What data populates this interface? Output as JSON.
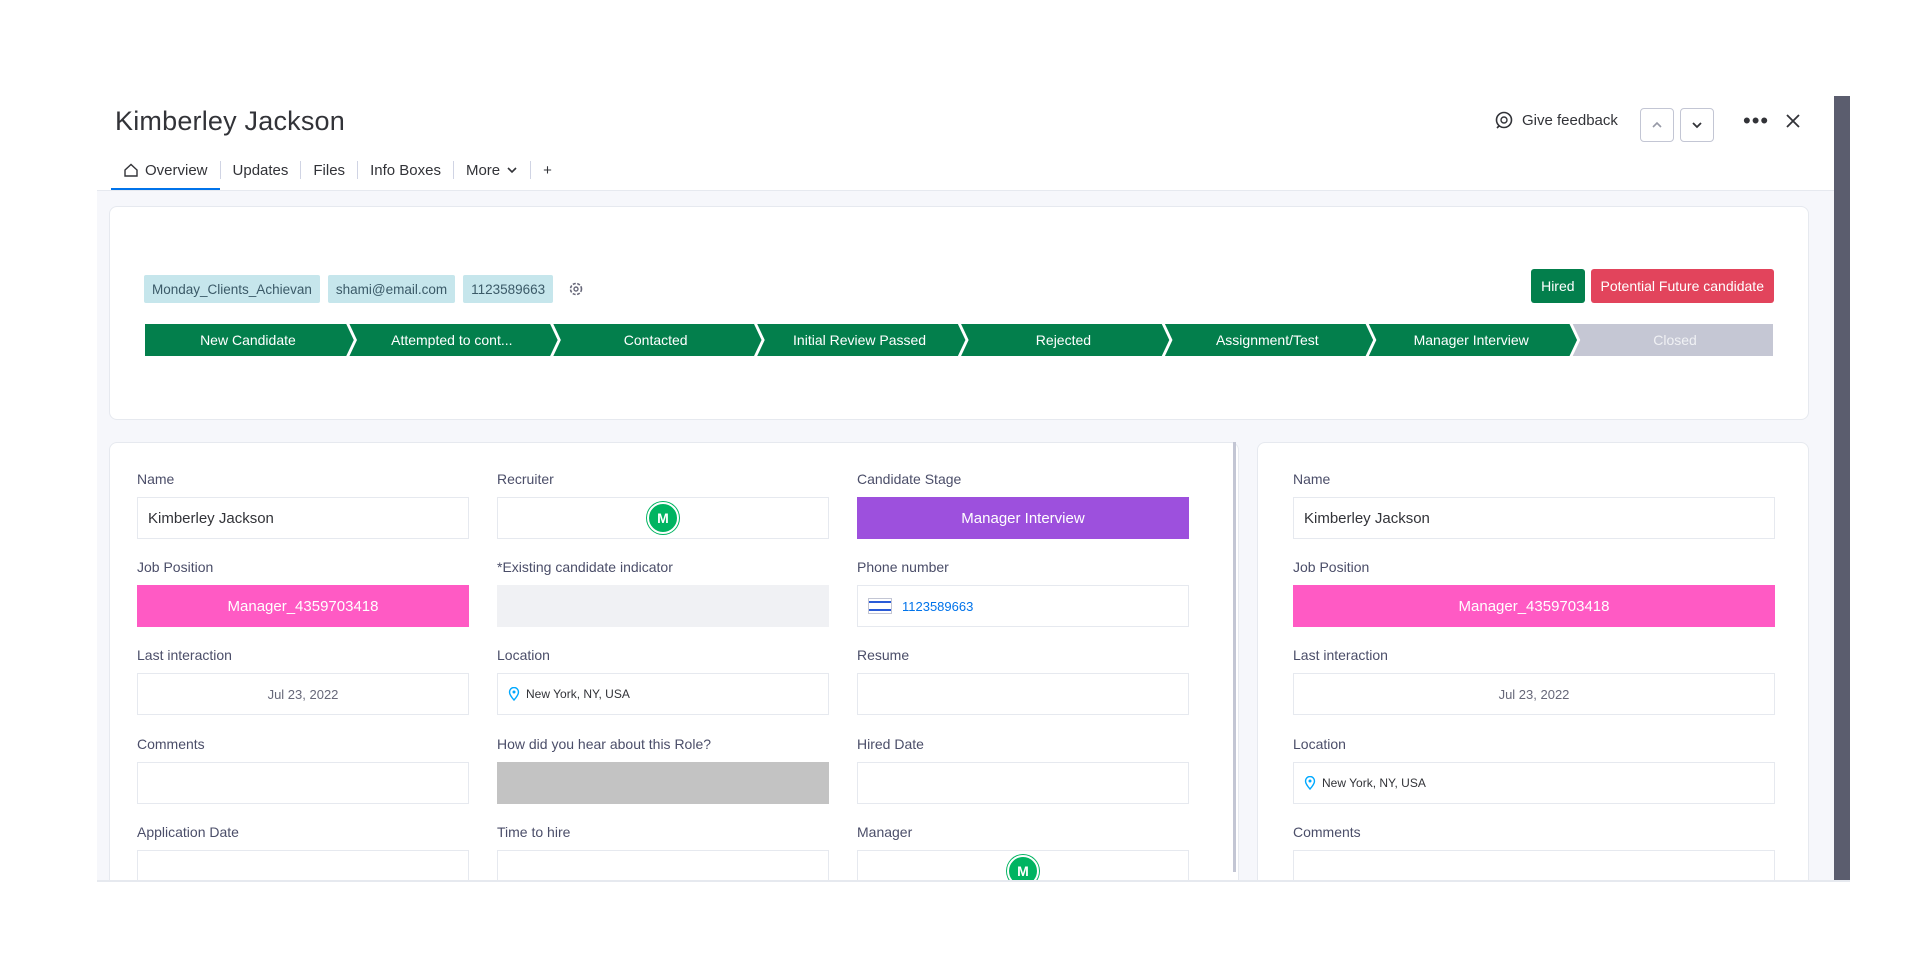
{
  "header": {
    "title": "Kimberley Jackson",
    "feedback_label": "Give feedback",
    "menu_label": "•••"
  },
  "tabs": [
    {
      "label": "Overview",
      "icon": "home-icon",
      "active": true
    },
    {
      "label": "Updates"
    },
    {
      "label": "Files"
    },
    {
      "label": "Info Boxes"
    },
    {
      "label": "More"
    },
    {
      "label": "+"
    }
  ],
  "stage_card": {
    "chips": [
      "Monday_Clients_Achievan",
      "shami@email.com",
      "1123589663"
    ],
    "status_tags": [
      {
        "label": "Hired",
        "color": "#037f4c"
      },
      {
        "label": "Potential Future candidate",
        "color": "#e2445c"
      }
    ],
    "pipeline": [
      {
        "label": "New Candidate",
        "done": true
      },
      {
        "label": "Attempted to cont...",
        "done": true
      },
      {
        "label": "Contacted",
        "done": true
      },
      {
        "label": "Initial Review Passed",
        "done": true
      },
      {
        "label": "Rejected",
        "done": true
      },
      {
        "label": "Assignment/Test",
        "done": true
      },
      {
        "label": "Manager Interview",
        "done": true
      },
      {
        "label": "Closed",
        "done": false
      }
    ],
    "pipeline_colors": {
      "done": "#037f4c",
      "pending": "#c5c7d4"
    }
  },
  "left_fields": {
    "name": {
      "label": "Name",
      "value": "Kimberley Jackson"
    },
    "recruiter": {
      "label": "Recruiter",
      "avatar": "M"
    },
    "candidate_stage": {
      "label": "Candidate Stage",
      "value": "Manager Interview"
    },
    "job_position": {
      "label": "Job Position",
      "value": "Manager_4359703418"
    },
    "existing_indicator": {
      "label": "*Existing candidate indicator"
    },
    "phone": {
      "label": "Phone number",
      "value": "1123589663"
    },
    "last_interaction": {
      "label": "Last interaction",
      "value": "Jul 23, 2022"
    },
    "location": {
      "label": "Location",
      "value": "New York, NY, USA"
    },
    "resume": {
      "label": "Resume"
    },
    "comments": {
      "label": "Comments"
    },
    "hear_about": {
      "label": "How did you hear about this Role?"
    },
    "hired_date": {
      "label": "Hired Date"
    },
    "application_date": {
      "label": "Application Date"
    },
    "time_to_hire": {
      "label": "Time to hire"
    },
    "manager": {
      "label": "Manager",
      "avatar": "M"
    }
  },
  "right_fields": {
    "name": {
      "label": "Name",
      "value": "Kimberley Jackson"
    },
    "job_position": {
      "label": "Job Position",
      "value": "Manager_4359703418"
    },
    "last_interaction": {
      "label": "Last interaction",
      "value": "Jul 23, 2022"
    },
    "location": {
      "label": "Location",
      "value": "New York, NY, USA"
    },
    "comments": {
      "label": "Comments"
    }
  }
}
